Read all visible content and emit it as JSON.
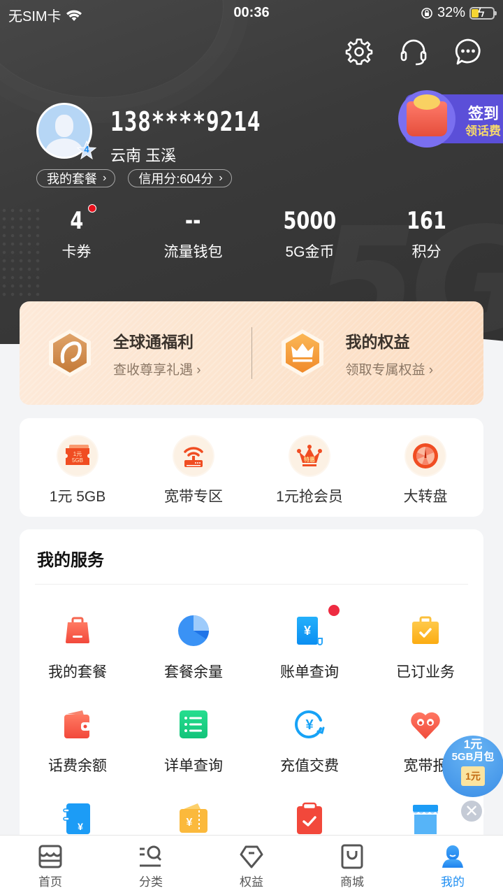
{
  "status_bar": {
    "carrier": "无SIM卡",
    "time": "00:36",
    "battery_percent": "32%",
    "battery_level": 0.32,
    "charging": true
  },
  "header_actions": [
    {
      "name": "settings",
      "icon": "gear-icon"
    },
    {
      "name": "customer-service",
      "icon": "headset-icon"
    },
    {
      "name": "messages",
      "icon": "chat-bubble-icon"
    }
  ],
  "profile": {
    "phone": "138****9214",
    "location": "云南 玉溪",
    "level": "4",
    "plan_pill": "我的套餐",
    "credit_pill": "信用分:604分"
  },
  "signin": {
    "title": "签到",
    "subtitle": "领话费"
  },
  "stats": [
    {
      "value": "4",
      "label": "卡券",
      "has_dot": true
    },
    {
      "value": "--",
      "label": "流量钱包"
    },
    {
      "value": "5000",
      "label": "5G金币"
    },
    {
      "value": "161",
      "label": "积分"
    }
  ],
  "benefits": [
    {
      "title": "全球通福利",
      "subtitle": "查收尊享礼遇",
      "icon": "globe-hex-icon"
    },
    {
      "title": "我的权益",
      "subtitle": "领取专属权益",
      "icon": "crown-hex-icon"
    }
  ],
  "quick_entries": [
    {
      "label": "1元 5GB",
      "icon": "data-ticket-icon",
      "icon_text_1": "1元",
      "icon_text_2": "5GB"
    },
    {
      "label": "宽带专区",
      "icon": "router-icon"
    },
    {
      "label": "1元抢会员",
      "icon": "crown-icon",
      "icon_text_1": "特惠"
    },
    {
      "label": "大转盘",
      "icon": "wheel-icon"
    }
  ],
  "services": {
    "title": "我的服务",
    "items": [
      {
        "label": "我的套餐",
        "icon": "bag-icon"
      },
      {
        "label": "套餐余量",
        "icon": "pie-chart-icon"
      },
      {
        "label": "账单查询",
        "icon": "bill-icon",
        "has_dot": true
      },
      {
        "label": "已订业务",
        "icon": "briefcase-check-icon"
      },
      {
        "label": "话费余额",
        "icon": "wallet-icon"
      },
      {
        "label": "详单查询",
        "icon": "list-icon"
      },
      {
        "label": "充值交费",
        "icon": "yuan-refresh-icon"
      },
      {
        "label": "宽带报",
        "icon": "heart-people-icon"
      },
      {
        "label": "",
        "icon": "notebook-yuan-icon"
      },
      {
        "label": "",
        "icon": "coupon-yuan-icon"
      },
      {
        "label": "",
        "icon": "clipboard-check-icon"
      },
      {
        "label": "",
        "icon": "store-icon"
      }
    ]
  },
  "promo": {
    "line1": "1元",
    "line2": "5GB月包",
    "ticket": "1元"
  },
  "tabbar": [
    {
      "label": "首页",
      "icon": "home-icon",
      "active": false
    },
    {
      "label": "分类",
      "icon": "category-search-icon",
      "active": false
    },
    {
      "label": "权益",
      "icon": "diamond-icon",
      "active": false
    },
    {
      "label": "商城",
      "icon": "shopping-bag-icon",
      "active": false
    },
    {
      "label": "我的",
      "icon": "profile-icon",
      "active": true
    }
  ],
  "colors": {
    "accent": "#1e8ef2",
    "header_bg": "#3a3a3a",
    "signin_bg": "#5b4fd8",
    "badge_red": "#e8101c"
  }
}
